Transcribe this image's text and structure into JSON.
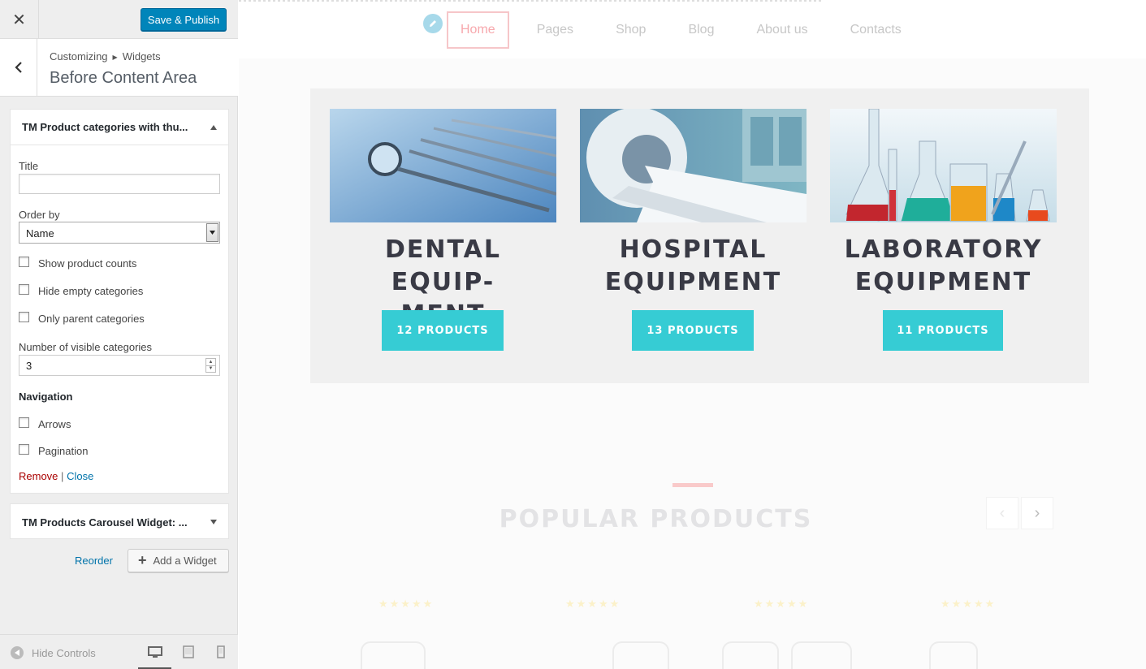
{
  "sidebar": {
    "close_icon": "close-icon",
    "save_label": "Save & Publish",
    "breadcrumb": [
      "Customizing",
      "Widgets"
    ],
    "section_title": "Before Content Area",
    "widget1": {
      "title": "TM Product categories with thu...",
      "fields": {
        "title_label": "Title",
        "title_value": "",
        "orderby_label": "Order by",
        "orderby_value": "Name",
        "show_counts": "Show product counts",
        "hide_empty": "Hide empty categories",
        "only_parent": "Only parent categories",
        "visible_label": "Number of visible categories",
        "visible_value": "3",
        "nav_heading": "Navigation",
        "arrows": "Arrows",
        "pagination": "Pagination"
      },
      "remove": "Remove",
      "separator": "|",
      "close": "Close"
    },
    "widget2": {
      "title": "TM Products Carousel Widget: ..."
    },
    "reorder": "Reorder",
    "add_widget": "Add a Widget",
    "footer": {
      "hide_controls": "Hide Controls"
    }
  },
  "preview": {
    "nav": [
      "Home",
      "Pages",
      "Shop",
      "Blog",
      "About us",
      "Contacts"
    ],
    "categories": [
      {
        "title_line1": "DENTAL EQUIP-",
        "title_line2": "MENT",
        "button": "12 PRODUCTS"
      },
      {
        "title_line1": "HOSPITAL",
        "title_line2": "EQUIPMENT",
        "button": "13 PRODUCTS"
      },
      {
        "title_line1": "LABORATORY",
        "title_line2": "EQUIPMENT",
        "button": "11 PRODUCTS"
      }
    ],
    "popular_title": "POPULAR PRODUCTS",
    "stars": "★★★★★"
  },
  "colors": {
    "accent_button": "#36ccd4",
    "publish_button": "#0085ba",
    "nav_active": "#f7a8ad",
    "link": "#0073aa",
    "remove": "#aa0000"
  }
}
